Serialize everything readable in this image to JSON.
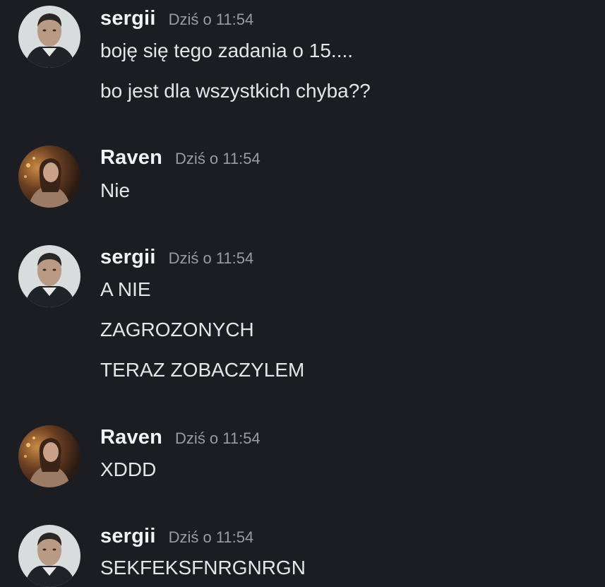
{
  "messages": [
    {
      "user": "sergii",
      "time": "Dziś o 11:54",
      "avatar": "sergii-avatar",
      "lines": [
        "boję się tego zadania o 15....",
        "bo jest dla wszystkich chyba??"
      ]
    },
    {
      "user": "Raven",
      "time": "Dziś o 11:54",
      "avatar": "raven-avatar",
      "lines": [
        "Nie"
      ]
    },
    {
      "user": "sergii",
      "time": "Dziś o 11:54",
      "avatar": "sergii-avatar",
      "lines": [
        "A NIE",
        "ZAGROZONYCH",
        "TERAZ ZOBACZYLEM"
      ]
    },
    {
      "user": "Raven",
      "time": "Dziś o 11:54",
      "avatar": "raven-avatar",
      "lines": [
        "XDDD"
      ]
    },
    {
      "user": "sergii",
      "time": "Dziś o 11:54",
      "avatar": "sergii-avatar",
      "lines": [
        "SEKFEKSFNRGNRGN"
      ]
    }
  ],
  "colors": {
    "background": "#1c1d22",
    "username": "#f2f3f5",
    "timestamp": "#9a9ca3",
    "message_text": "#e3e5e8"
  }
}
